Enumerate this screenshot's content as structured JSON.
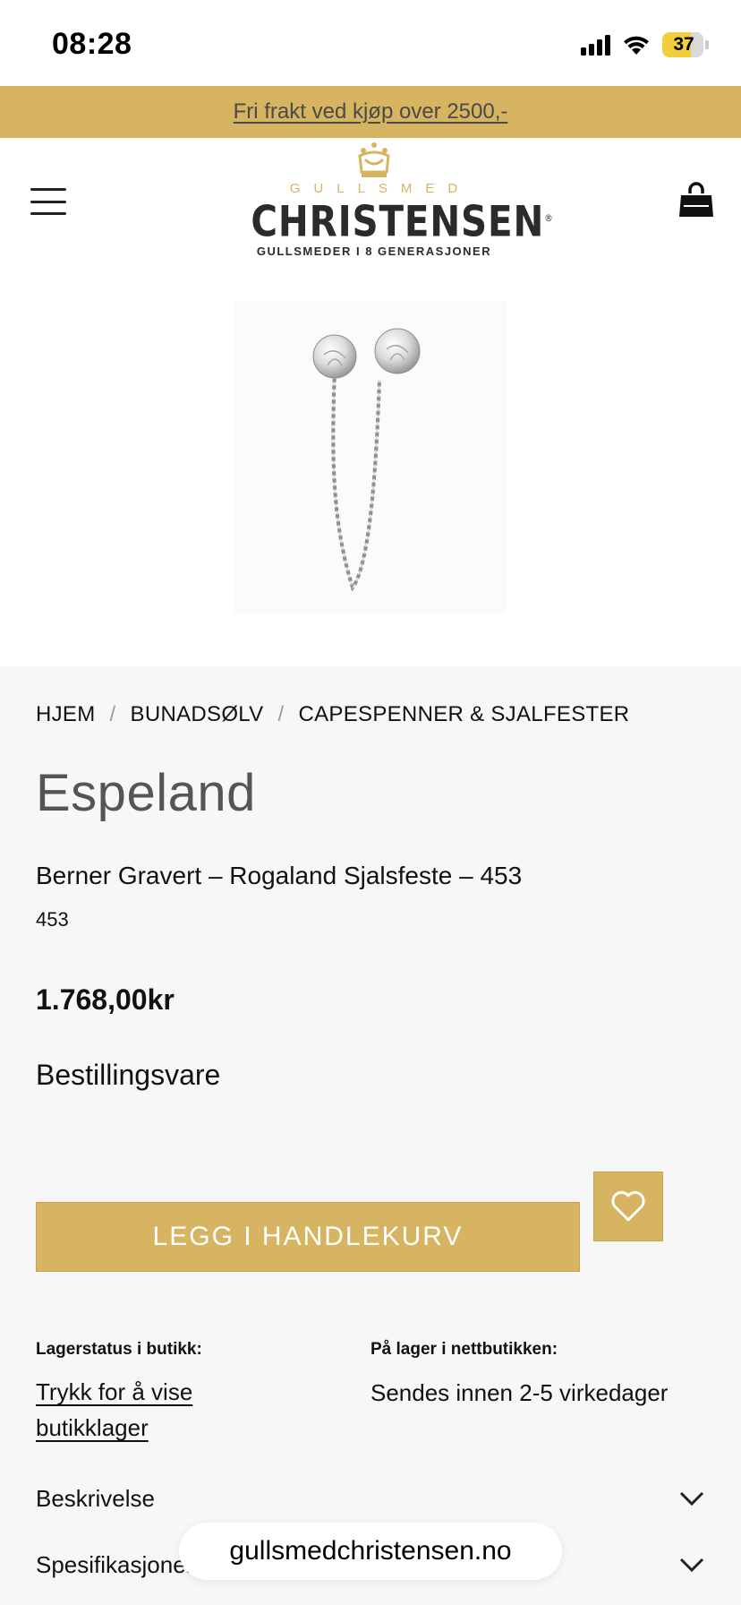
{
  "status_bar": {
    "time": "08:28",
    "battery": "37",
    "icons": [
      "signal-icon",
      "wifi-icon",
      "battery-icon"
    ]
  },
  "promo": {
    "text": "Fri frakt ved kjøp over 2500,-"
  },
  "header": {
    "menu_icon": "hamburger-menu-icon",
    "logo": {
      "small": "GULLSMED",
      "main": "CHRISTENSEN",
      "registered": "®",
      "tagline": "GULLSMEDER I 8 GENERASJONER"
    },
    "cart_icon": "shopping-bag-icon"
  },
  "breadcrumb": {
    "items": [
      "HJEM",
      "BUNADSØLV",
      "CAPESPENNER & SJALFESTER"
    ],
    "separator": "/"
  },
  "product": {
    "title": "Espeland",
    "subtitle": "Berner Gravert – Rogaland Sjalsfeste – 453",
    "sku": "453",
    "price": "1.768,00kr",
    "availability": "Bestillingsvare",
    "add_to_cart_label": "LEGG I HANDLEKURV",
    "wishlist_icon": "heart-icon"
  },
  "stock": {
    "store_label": "Lagerstatus i butikk:",
    "store_link": "Trykk for å vise butikklager",
    "online_label": "På lager i nettbutikken:",
    "online_text": "Sendes innen 2-5 virkedager"
  },
  "accordion": {
    "items": [
      "Beskrivelse",
      "Spesifikasjoner"
    ]
  },
  "browser": {
    "url": "gullsmedchristensen.no"
  },
  "colors": {
    "accent": "#d6b461",
    "panel_bg": "#f7f7f7"
  }
}
